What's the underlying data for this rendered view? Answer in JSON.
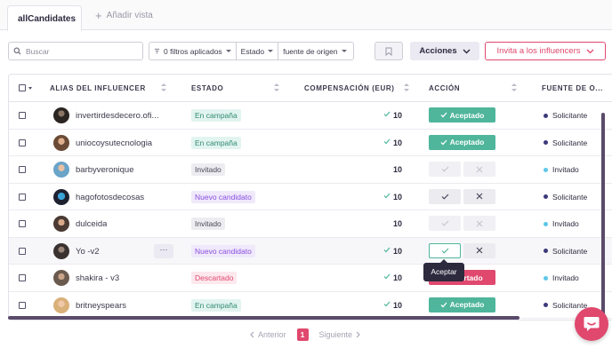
{
  "tabs": {
    "active_label": "allCandidates",
    "add_label": "Añadir vista"
  },
  "toolbar": {
    "search_placeholder": "Buscar",
    "filters_label": "0 filtros aplicados",
    "estado_label": "Estado",
    "fuente_label": "fuente de origen",
    "acciones_label": "Acciones",
    "invite_label": "Invita a los influencers"
  },
  "table": {
    "headers": {
      "alias": "ALIAS DEL INFLUENCER",
      "estado": "ESTADO",
      "compensacion": "COMPENSACIÓN (EUR)",
      "accion": "ACCIÓN",
      "fuente": "FUENTE DE O..."
    },
    "accept_label": "Aceptado",
    "discard_label": "Descartado",
    "rows": [
      {
        "alias": "invertirdesdecero.ofi...",
        "estado": "En campaña",
        "comp": "10",
        "fuente": "Solicitante"
      },
      {
        "alias": "uniocoysutecnologia",
        "estado": "En campaña",
        "comp": "10",
        "fuente": "Solicitante"
      },
      {
        "alias": "barbyveronique",
        "estado": "Invitado",
        "comp": "10",
        "fuente": "Invitado"
      },
      {
        "alias": "hagofotosdecosas",
        "estado": "Nuevo candidato",
        "comp": "10",
        "fuente": "Solicitante"
      },
      {
        "alias": "dulceida",
        "estado": "Invitado",
        "comp": "10",
        "fuente": "Invitado"
      },
      {
        "alias": "Yo -v2",
        "estado": "Nuevo candidato",
        "comp": "10",
        "fuente": "Solicitante"
      },
      {
        "alias": "shakira - v3",
        "estado": "Descartado",
        "comp": "10",
        "fuente": "Invitado"
      },
      {
        "alias": "britneyspears",
        "estado": "En campaña",
        "comp": "10",
        "fuente": "Solicitante"
      }
    ],
    "more_label": "···"
  },
  "tooltip": {
    "text": "Aceptar"
  },
  "pagination": {
    "prev": "Anterior",
    "page": "1",
    "next": "Siguiente"
  },
  "colors": {
    "accent": "#e0486e",
    "accepted": "#4fb59b",
    "solicitante_dot": "#3b3a7a",
    "invitado_dot": "#5cc7e8"
  }
}
